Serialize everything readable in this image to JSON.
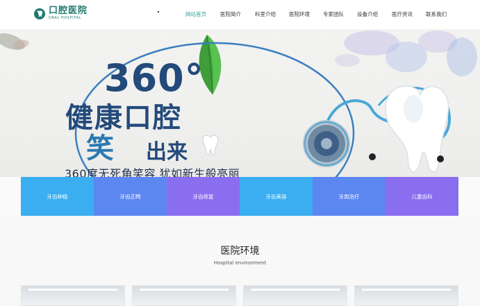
{
  "header": {
    "logo_cn": "口腔医院",
    "logo_en": "ORAL HOSPITAL",
    "nav": [
      {
        "label": "网站首页",
        "active": true
      },
      {
        "label": "医院简介",
        "active": false
      },
      {
        "label": "科室介绍",
        "active": false
      },
      {
        "label": "医院环境",
        "active": false
      },
      {
        "label": "专家团队",
        "active": false
      },
      {
        "label": "设备介绍",
        "active": false
      },
      {
        "label": "医疗资讯",
        "active": false
      },
      {
        "label": "联系我们",
        "active": false
      }
    ]
  },
  "banner": {
    "headline_num": "360°",
    "headline_line1": "健康口腔",
    "headline_line2a": "笑",
    "headline_line2b": "出来",
    "subline": "360度无死角笑容 犹如新生般亮丽"
  },
  "categories": [
    {
      "label": "牙齿种植",
      "color": "#3aaef0"
    },
    {
      "label": "牙齿正畸",
      "color": "#5c86f0"
    },
    {
      "label": "牙齿修复",
      "color": "#8a6ef0"
    },
    {
      "label": "牙齿美容",
      "color": "#3aaef0"
    },
    {
      "label": "牙周治疗",
      "color": "#5c86f0"
    },
    {
      "label": "儿童齿科",
      "color": "#8a6ef0"
    }
  ],
  "section": {
    "title": "医院环境",
    "subtitle": "Hospital environment"
  },
  "colors": {
    "brand": "#1f7a6e",
    "nav_active": "#2aa59a",
    "headline": "#234a7a"
  }
}
